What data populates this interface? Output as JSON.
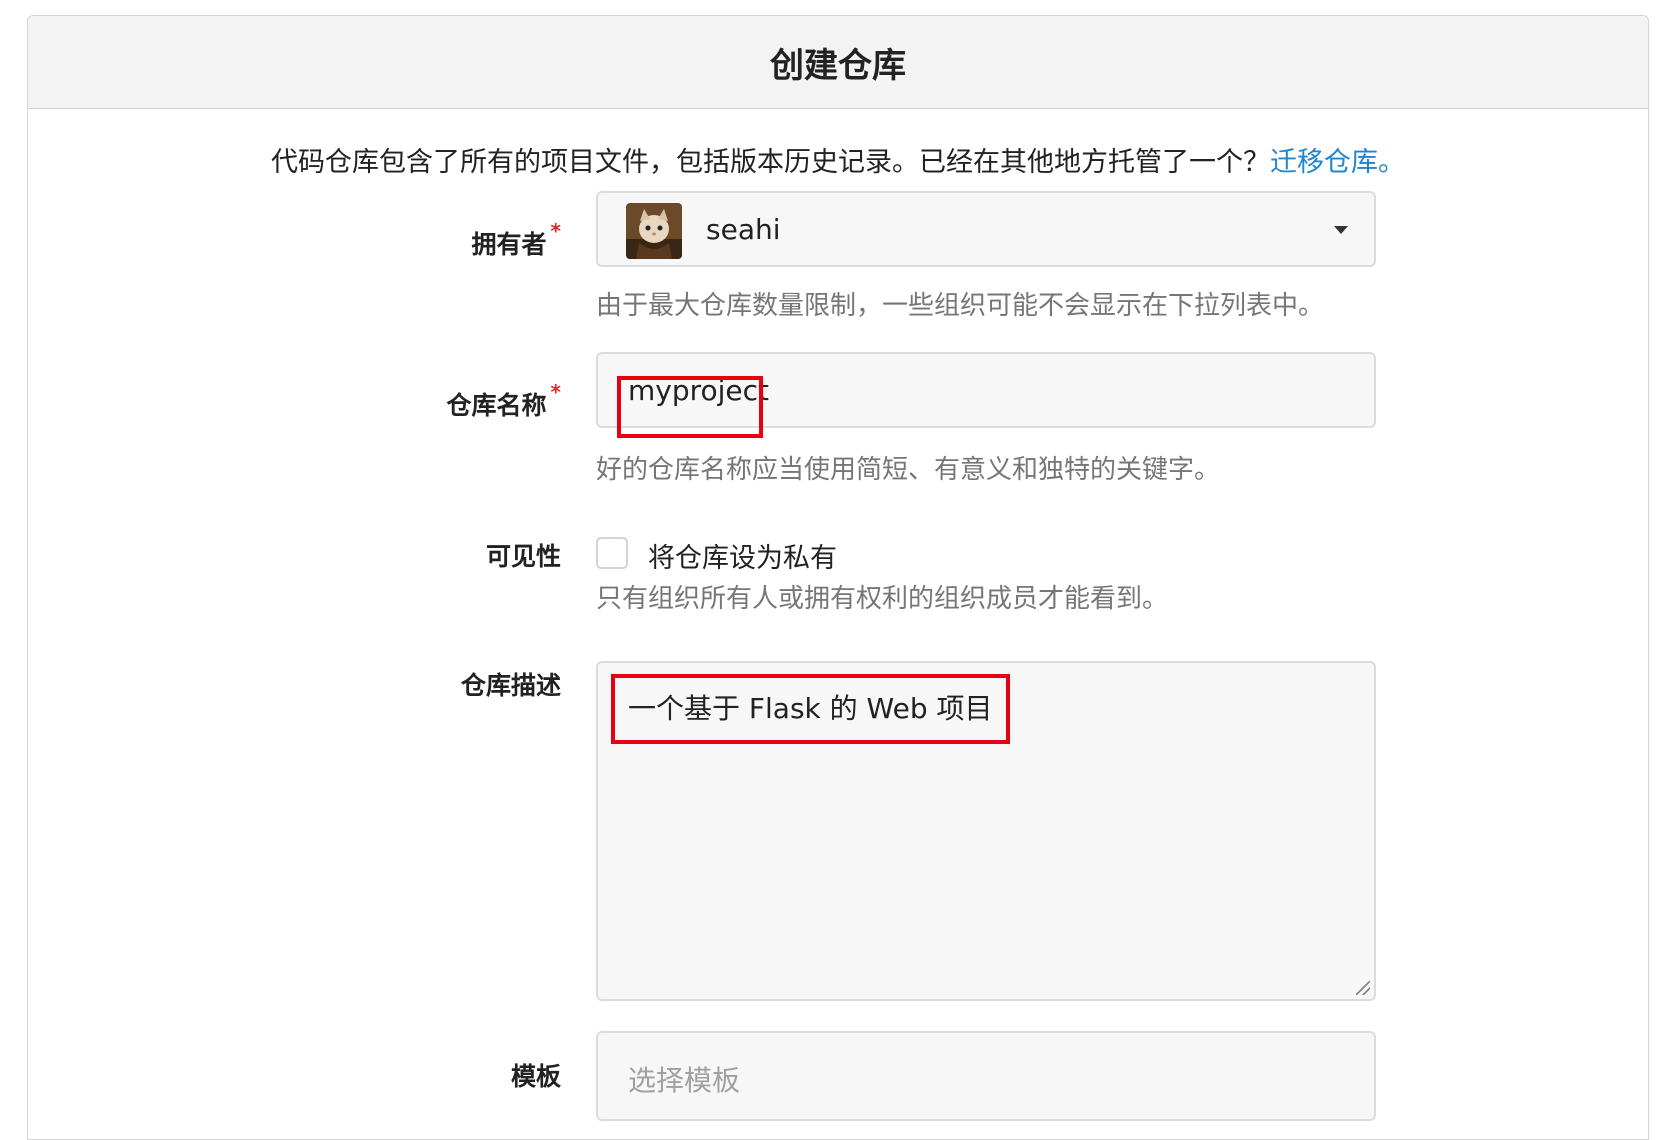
{
  "header": {
    "title": "创建仓库"
  },
  "intro": {
    "text": "代码仓库包含了所有的项目文件，包括版本历史记录。已经在其他地方托管了一个？",
    "link": "迁移仓库。"
  },
  "owner": {
    "label": "拥有者",
    "required_mark": "*",
    "selected": "seahi",
    "help": "由于最大仓库数量限制，一些组织可能不会显示在下拉列表中。"
  },
  "repo_name": {
    "label": "仓库名称",
    "required_mark": "*",
    "value": "myproject",
    "help": "好的仓库名称应当使用简短、有意义和独特的关键字。"
  },
  "visibility": {
    "label": "可见性",
    "checkbox_label": "将仓库设为私有",
    "checked": false,
    "help": "只有组织所有人或拥有权利的组织成员才能看到。"
  },
  "description": {
    "label": "仓库描述",
    "value": "一个基于 Flask 的 Web 项目"
  },
  "template": {
    "label": "模板",
    "placeholder": "选择模板"
  },
  "colors": {
    "link": "#2185d0",
    "required": "#db2828",
    "highlight": "#e60012"
  }
}
